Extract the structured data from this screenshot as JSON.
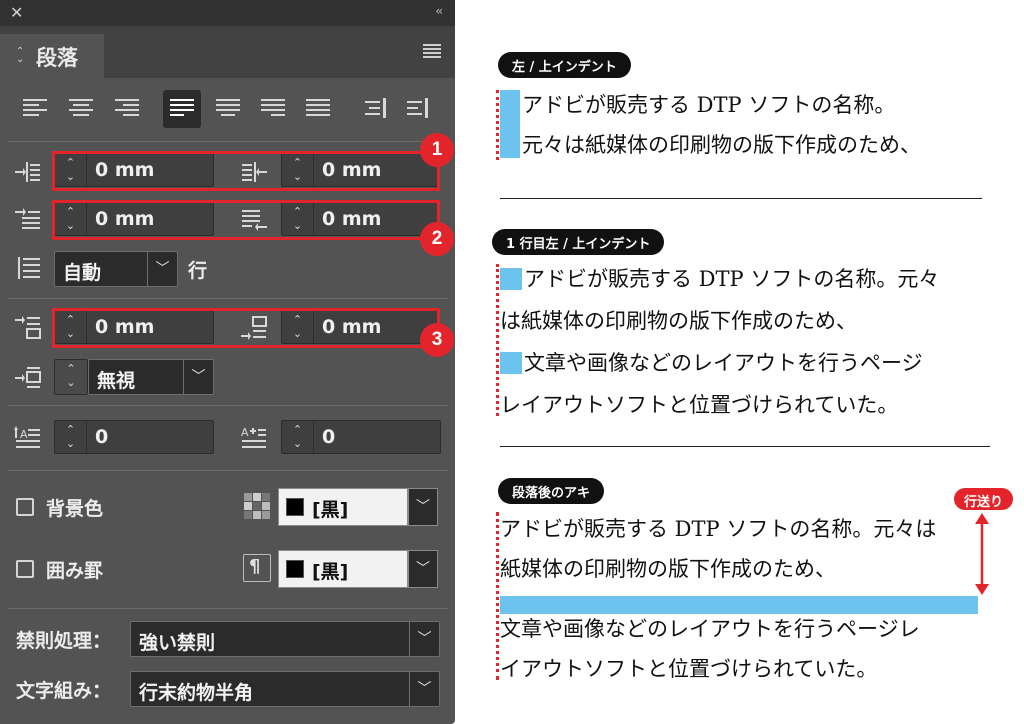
{
  "panel": {
    "tab_label": "段落",
    "menu_icon": "hamburger-icon",
    "indent_fields": {
      "left_indent": "0 mm",
      "right_indent": "0 mm",
      "first_line_indent": "0 mm",
      "last_line_indent": "0 mm",
      "space_before": "0 mm",
      "space_after": "0 mm"
    },
    "leading": {
      "value": "自動",
      "unit_label": "行"
    },
    "grid_align": {
      "value": "無視"
    },
    "drop_cap": {
      "lines": "0",
      "chars": "0"
    },
    "shading": {
      "label": "背景色",
      "color": "[黒]"
    },
    "border": {
      "label": "囲み罫",
      "color": "[黒]"
    },
    "kinsoku": {
      "label": "禁則処理：",
      "value": "強い禁則"
    },
    "mojikumi": {
      "label": "文字組み：",
      "value": "行末約物半角"
    },
    "callouts": [
      "1",
      "2",
      "3"
    ]
  },
  "illustrations": {
    "ex1": {
      "tag": "左 / 上インデント",
      "lines": [
        "アドビが販売する DTP ソフトの名称。",
        "元々は紙媒体の印刷物の版下作成のため、"
      ]
    },
    "ex2": {
      "tag": "1 行目左 / 上インデント",
      "lines": [
        "アドビが販売する DTP ソフトの名称。元々",
        "は紙媒体の印刷物の版下作成のため、",
        "文章や画像などのレイアウトを行うページ",
        "レイアウトソフトと位置づけられていた。"
      ]
    },
    "ex3": {
      "tag": "段落後のアキ",
      "leading_tag": "行送り",
      "lines": [
        "アドビが販売する DTP ソフトの名称。元々は",
        "紙媒体の印刷物の版下作成のため、",
        "文章や画像などのレイアウトを行うページレ",
        "イアウトソフトと位置づけられていた。"
      ]
    }
  },
  "colors": {
    "panel_bg": "#535353",
    "highlight_red": "#e3242b",
    "indent_blue": "#6cc4ee"
  }
}
